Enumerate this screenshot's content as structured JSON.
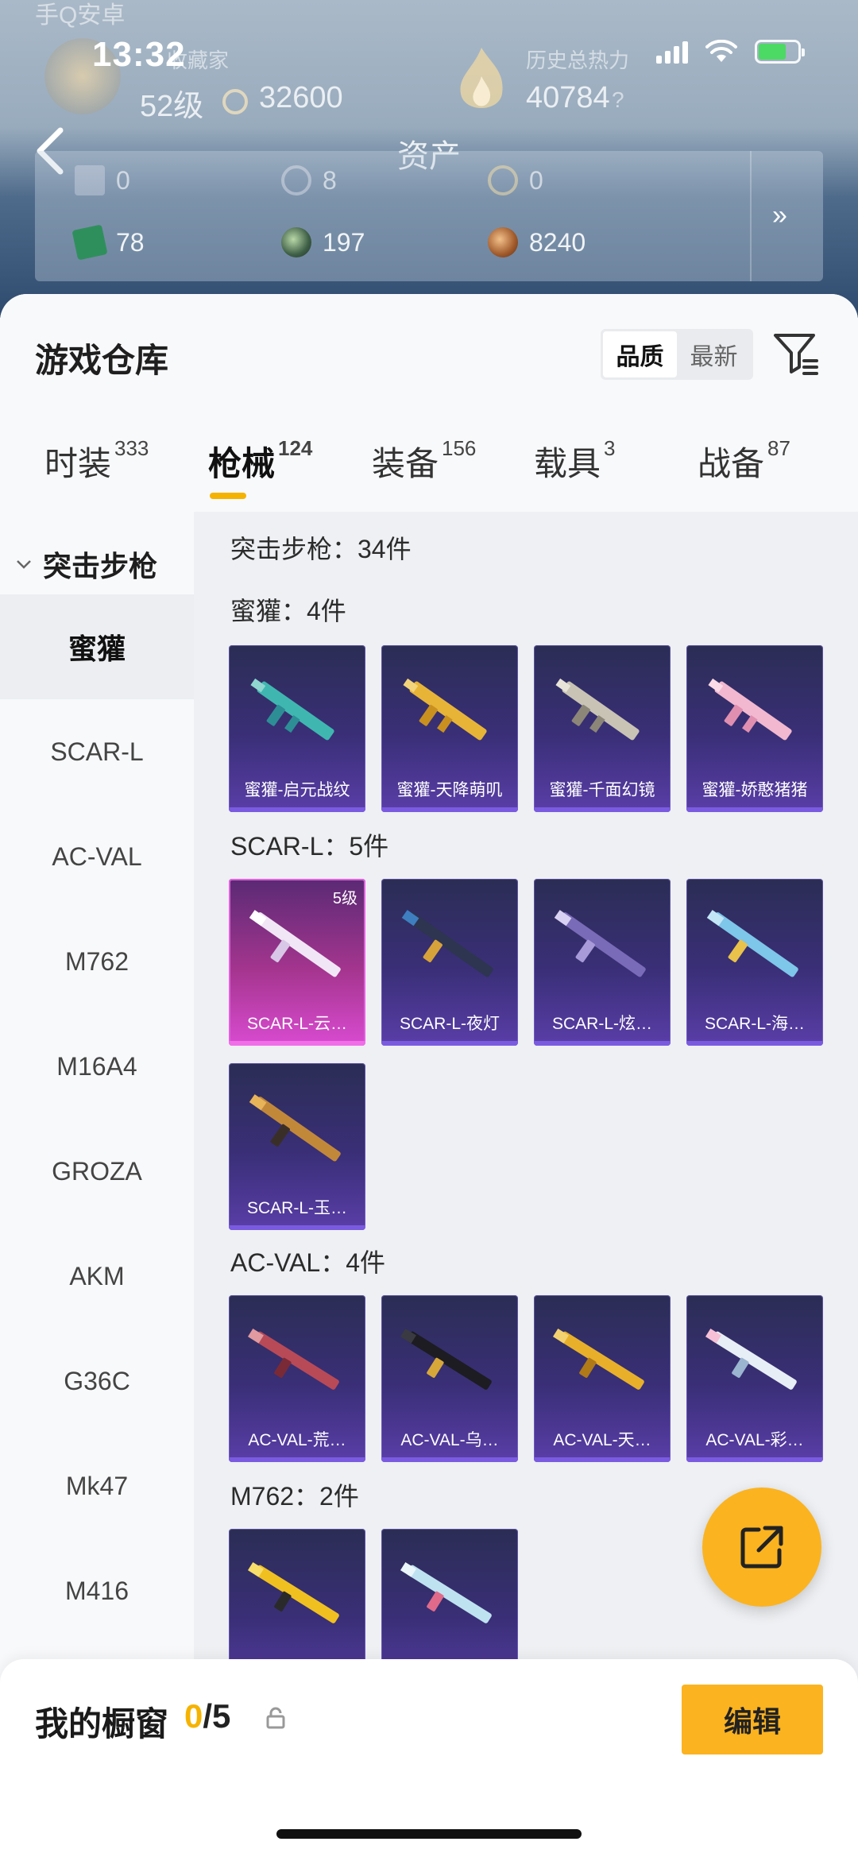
{
  "status_bar": {
    "time": "13:32"
  },
  "header": {
    "app_name_ghost": "手Q安卓",
    "collector_label": "收藏家",
    "level": "52级",
    "points": "32600",
    "heat_label": "历史总热力",
    "heat_value": "40784",
    "heat_help": "?",
    "page_title": "资产"
  },
  "assets": {
    "row1": [
      "0",
      "8",
      "0"
    ],
    "row2": [
      "78",
      "197",
      "8240"
    ],
    "more": "»"
  },
  "warehouse": {
    "title": "游戏仓库",
    "sort": {
      "quality": "品质",
      "newest": "最新"
    }
  },
  "tabs": [
    {
      "label": "时装",
      "count": "333"
    },
    {
      "label": "枪械",
      "count": "124"
    },
    {
      "label": "装备",
      "count": "156"
    },
    {
      "label": "载具",
      "count": "3"
    },
    {
      "label": "战备",
      "count": "87"
    }
  ],
  "category": {
    "header": "突击步枪",
    "items": [
      "蜜獾",
      "SCAR-L",
      "AC-VAL",
      "M762",
      "M16A4",
      "GROZA",
      "AKM",
      "G36C",
      "Mk47",
      "M416"
    ]
  },
  "content": {
    "total_label": "突击步枪：34件",
    "sections": [
      {
        "label": "蜜獾：4件",
        "items": [
          "蜜獾-启元战纹",
          "蜜獾-天降萌叽",
          "蜜獾-千面幻镜",
          "蜜獾-娇憨猪猪"
        ]
      },
      {
        "label": "SCAR-L：5件",
        "items": [
          "SCAR-L-云…",
          "SCAR-L-夜灯",
          "SCAR-L-炫…",
          "SCAR-L-海…",
          "SCAR-L-玉…"
        ],
        "level_badge": "5级"
      },
      {
        "label": "AC-VAL：4件",
        "items": [
          "AC-VAL-荒…",
          "AC-VAL-乌…",
          "AC-VAL-天…",
          "AC-VAL-彩…"
        ]
      },
      {
        "label": "M762：2件",
        "items": [
          "",
          ""
        ]
      }
    ]
  },
  "showcase": {
    "label": "我的橱窗",
    "current": "0",
    "total": "/5",
    "edit_label": "编辑"
  },
  "colors": {
    "accent": "#fbb320",
    "card_purple": "#3a2f78",
    "card_pink": "#d94bd1"
  }
}
